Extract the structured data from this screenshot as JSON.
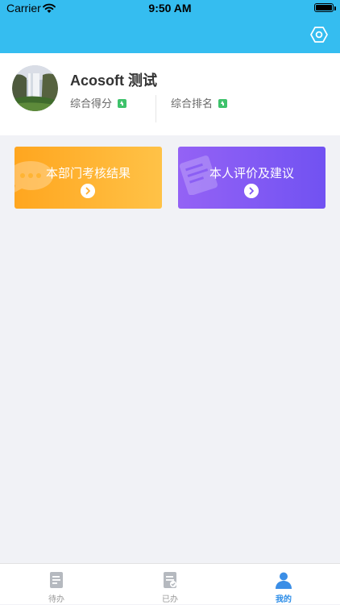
{
  "status_bar": {
    "carrier": "Carrier",
    "time": "9:50 AM"
  },
  "header": {
    "settings_icon": "settings-icon"
  },
  "profile": {
    "name": "Acosoft 测试",
    "score_label": "综合得分",
    "rank_label": "综合排名",
    "indicator_icon": "arrow-up-icon"
  },
  "cards": [
    {
      "title": "本部门考核结果",
      "icon": "chat-bubble-icon",
      "color": "#ffae2e"
    },
    {
      "title": "本人评价及建议",
      "icon": "document-icon",
      "color": "#7f58f3"
    }
  ],
  "tabbar": {
    "items": [
      {
        "label": "待办",
        "icon": "todo-document-icon",
        "active": false
      },
      {
        "label": "已办",
        "icon": "done-document-icon",
        "active": false
      },
      {
        "label": "我的",
        "icon": "person-icon",
        "active": true
      }
    ],
    "active_color": "#2c8de8"
  }
}
